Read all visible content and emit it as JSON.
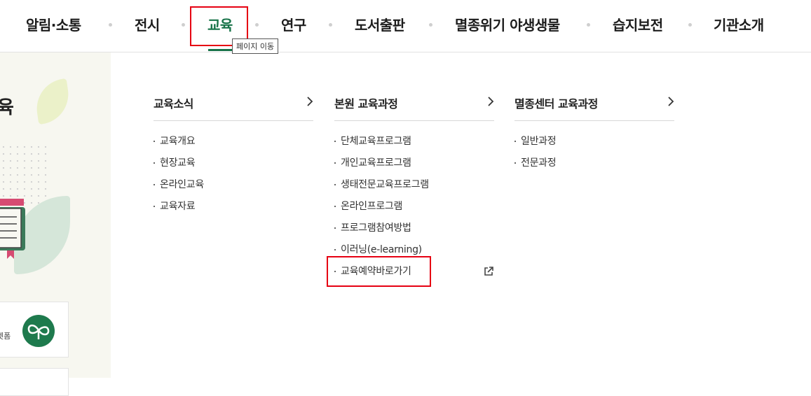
{
  "nav": {
    "items": [
      {
        "label": "알림·소통"
      },
      {
        "label": "전시"
      },
      {
        "label": "교육"
      },
      {
        "label": "연구"
      },
      {
        "label": "도서출판"
      },
      {
        "label": "멸종위기 야생생물"
      },
      {
        "label": "습지보전"
      },
      {
        "label": "기관소개"
      }
    ],
    "tooltip": "페이지 이동",
    "active_color": "#187349"
  },
  "side": {
    "title": "육",
    "card_label": "렛폼"
  },
  "menu": {
    "columns": [
      {
        "title": "교육소식",
        "items": [
          "교육개요",
          "현장교육",
          "온라인교육",
          "교육자료"
        ]
      },
      {
        "title": "본원 교육과정",
        "items": [
          "단체교육프로그램",
          "개인교육프로그램",
          "생태전문교육프로그램",
          "온라인프로그램",
          "프로그램참여방법",
          "이러닝(e-learning)",
          "교육예약바로가기"
        ]
      },
      {
        "title": "멸종센터 교육과정",
        "items": [
          "일반과정",
          "전문과정"
        ]
      }
    ]
  },
  "icons": {
    "arrow": "chevron-right-icon",
    "external": "external-link-icon"
  },
  "highlight_color": "#e60012"
}
